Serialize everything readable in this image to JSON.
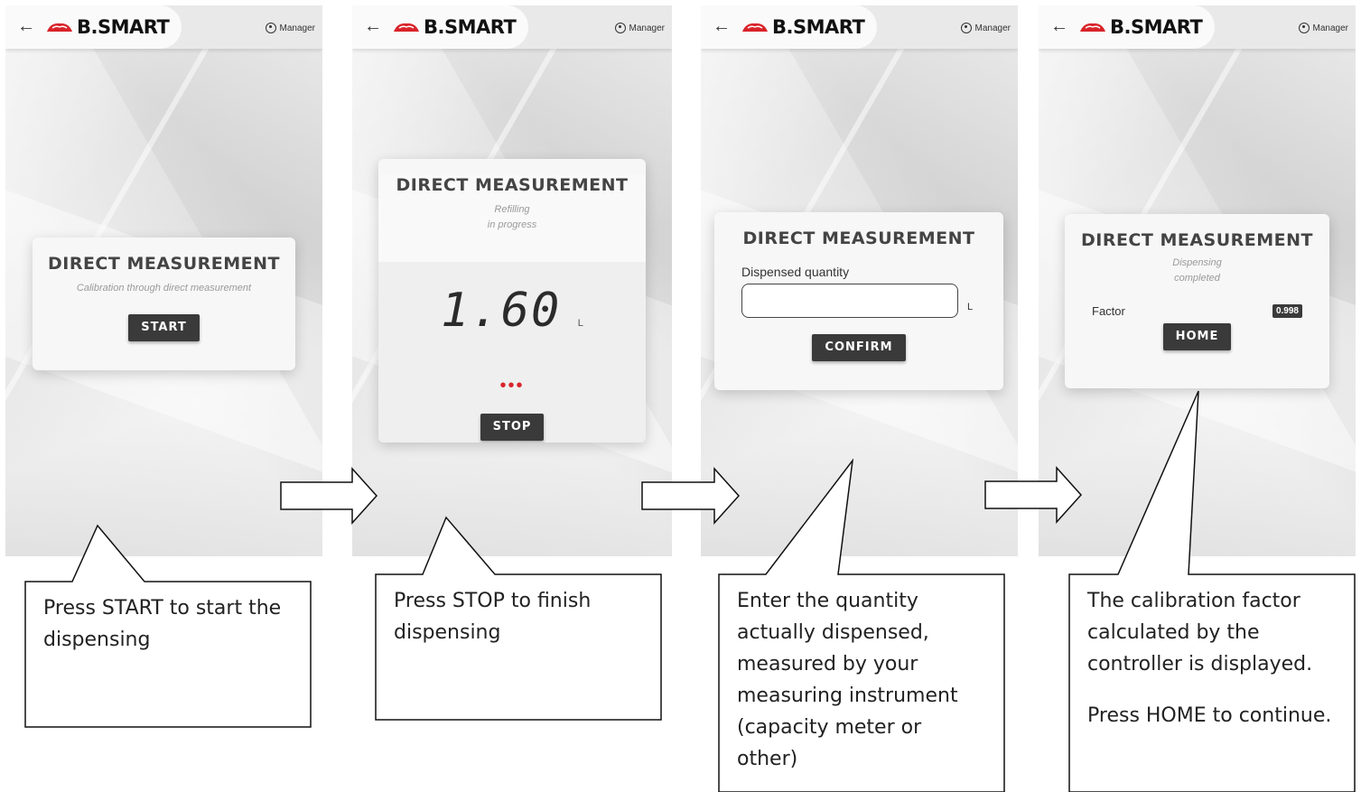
{
  "app": {
    "brand": "B.SMART",
    "user": "Manager",
    "brand_color": "#d9232a"
  },
  "screens": [
    {
      "card_title": "DIRECT MEASUREMENT",
      "card_subtitle": "Calibration through direct measurement",
      "button": "START"
    },
    {
      "card_title": "DIRECT MEASUREMENT",
      "card_subtitle_line1": "Refilling",
      "card_subtitle_line2": "in progress",
      "display_value": "1.60",
      "display_unit": "L",
      "progress_dots": "•••",
      "button": "STOP"
    },
    {
      "card_title": "DIRECT MEASUREMENT",
      "field_label": "Dispensed quantity",
      "field_value": "",
      "field_unit": "L",
      "button": "CONFIRM"
    },
    {
      "card_title": "DIRECT MEASUREMENT",
      "card_subtitle_line1": "Dispensing",
      "card_subtitle_line2": "completed",
      "factor_label": "Factor",
      "factor_value": "0.998",
      "button": "HOME"
    }
  ],
  "callouts": [
    {
      "text": "Press START to start the dispensing"
    },
    {
      "text": "Press STOP to finish dispensing"
    },
    {
      "text": "Enter the quantity actually dispensed, measured by your measuring instrument (capacity meter or other)"
    },
    {
      "text": "The calibration factor calculated by the controller is displayed.",
      "text2": "Press HOME to continue."
    }
  ]
}
